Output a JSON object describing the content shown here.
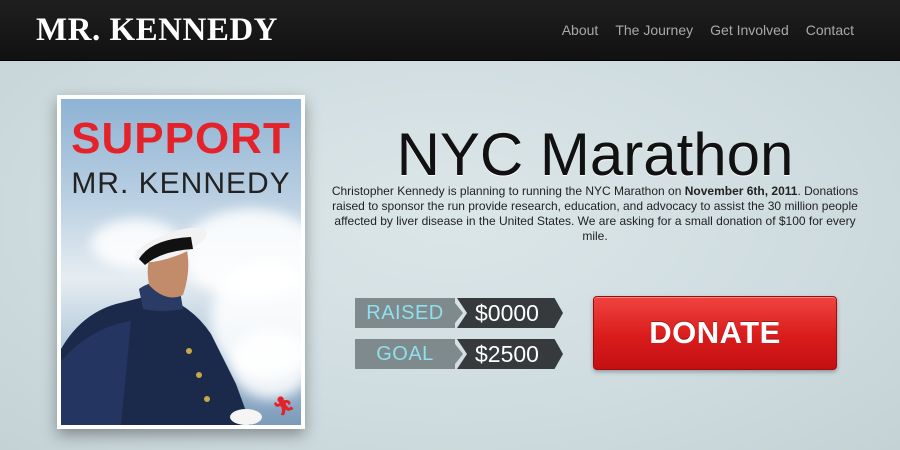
{
  "header": {
    "brand": "MR. KENNEDY",
    "nav": [
      "About",
      "The Journey",
      "Get Involved",
      "Contact"
    ]
  },
  "poster": {
    "headline": "SUPPORT",
    "subhead": "MR. KENNEDY",
    "icon": "runner-icon"
  },
  "hero": {
    "title": "NYC Marathon",
    "description_before": "Christopher Kennedy is planning to running the NYC Marathon on ",
    "description_date": "November 6th, 2011",
    "description_after": ". Donations raised to sponsor the run provide research, education, and advocacy to assist the 30 million people affected by liver disease in the United States. We are asking for a small donation of $100 for every mile."
  },
  "stats": {
    "raised_label": "RAISED",
    "raised_value": "$0000",
    "goal_label": "GOAL",
    "goal_value": "$2500"
  },
  "donate": {
    "label": "DONATE"
  },
  "colors": {
    "accent_red": "#e32329",
    "nav_bg": "#1a1a1a",
    "label_text": "#8fe0ee"
  }
}
